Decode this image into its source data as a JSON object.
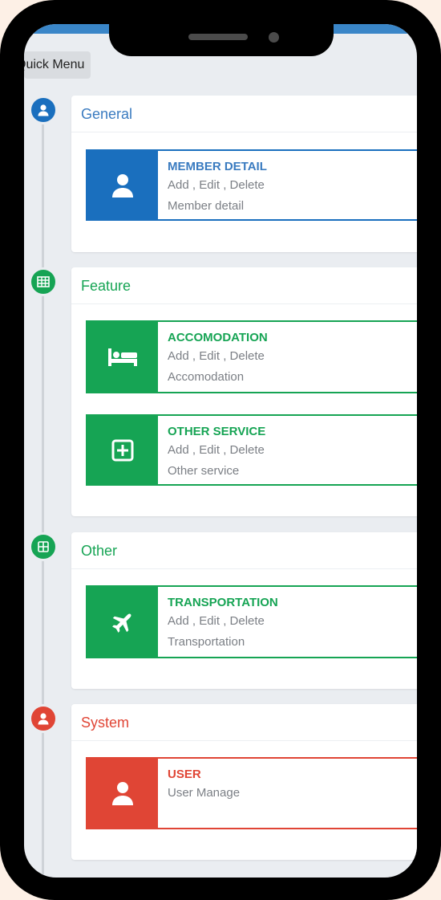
{
  "quick_menu": {
    "label": "Quick Menu"
  },
  "colors": {
    "general": "#1a6fbe",
    "feature": "#16a454",
    "other": "#16a454",
    "system": "#e04535"
  },
  "sections": [
    {
      "title": "General",
      "dot_icon": "user-icon",
      "cards": [
        {
          "title": "MEMBER DETAIL",
          "line1": "Add , Edit , Delete",
          "line2": "Member detail",
          "icon": "user-icon"
        }
      ]
    },
    {
      "title": "Feature",
      "dot_icon": "table-icon",
      "cards": [
        {
          "title": "ACCOMODATION",
          "line1": "Add , Edit , Delete",
          "line2": "Accomodation",
          "icon": "bed-icon"
        },
        {
          "title": "OTHER SERVICE",
          "line1": "Add , Edit , Delete",
          "line2": "Other service",
          "icon": "plus-square-icon"
        }
      ]
    },
    {
      "title": "Other",
      "dot_icon": "grid-icon",
      "cards": [
        {
          "title": "TRANSPORTATION",
          "line1": "Add , Edit , Delete",
          "line2": "Transportation",
          "icon": "plane-icon"
        }
      ]
    },
    {
      "title": "System",
      "dot_icon": "user-icon",
      "cards": [
        {
          "title": "USER",
          "line1": "User Manage",
          "icon": "user-icon"
        }
      ]
    }
  ]
}
